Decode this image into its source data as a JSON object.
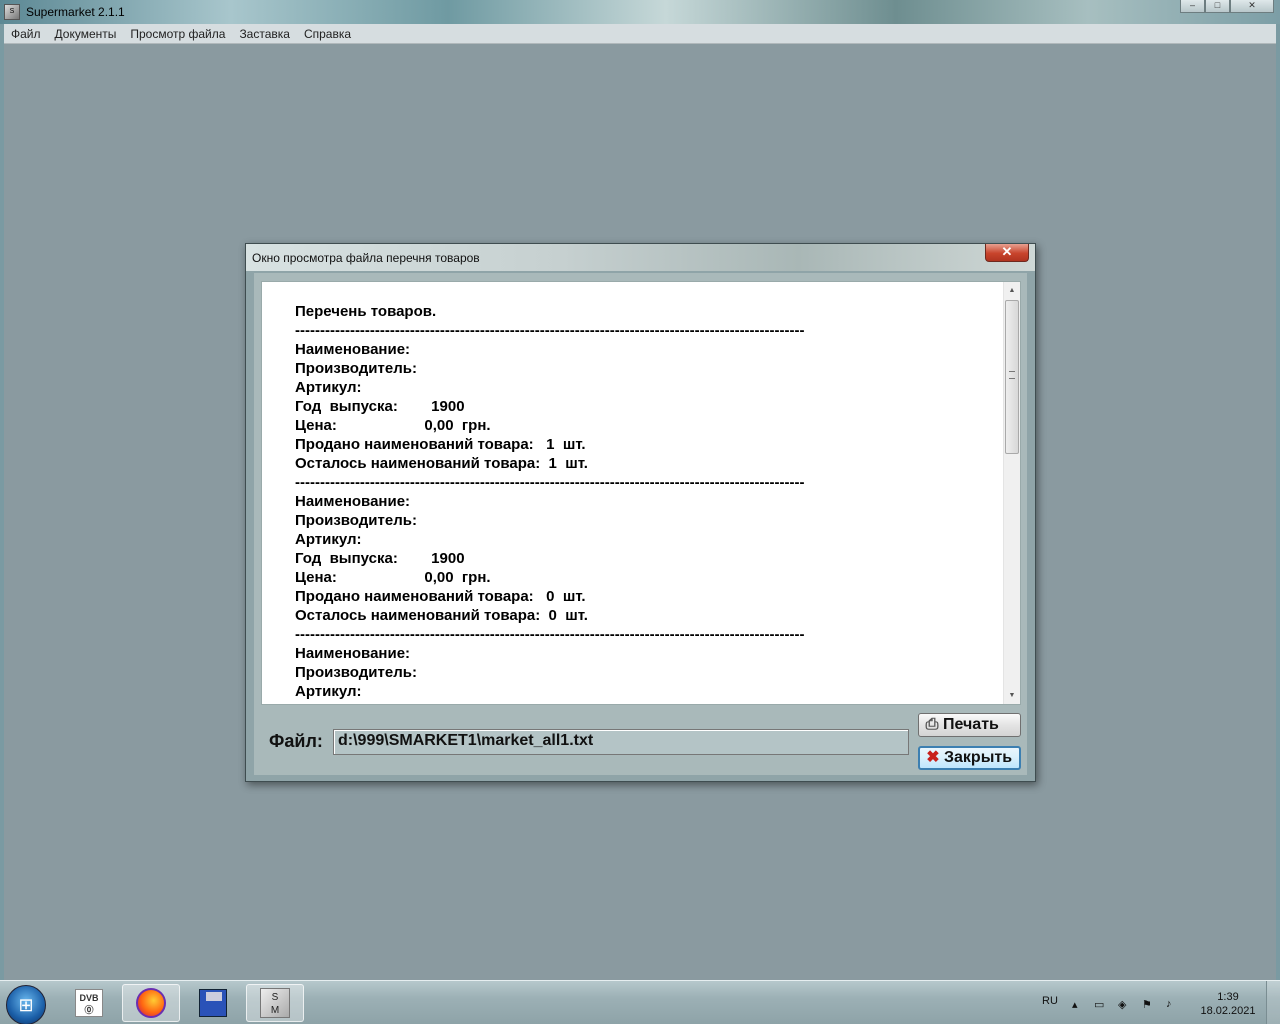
{
  "window": {
    "title": "Supermarket 2.1.1",
    "controls": {
      "minimize": "–",
      "maximize": "□",
      "close": "✕"
    }
  },
  "menu": {
    "items": [
      {
        "label": "Файл"
      },
      {
        "label": "Документы"
      },
      {
        "label": "Просмотр файла"
      },
      {
        "label": "Заставка"
      },
      {
        "label": "Справка"
      }
    ]
  },
  "dialog": {
    "title": "Окно просмотра файла перечня товаров",
    "close_label": "✕",
    "memo_text": "Перечень товаров.\n------------------------------------------------------------------------------------------------------\nНаименование:\nПроизводитель:\nАртикул:\nГод  выпуска:        1900\nЦена:                     0,00  грн.\nПродано наименований товара:   1  шт.\nОсталось наименований товара:  1  шт.\n------------------------------------------------------------------------------------------------------\nНаименование:\nПроизводитель:\nАртикул:\nГод  выпуска:        1900\nЦена:                     0,00  грн.\nПродано наименований товара:   0  шт.\nОсталось наименований товара:  0  шт.\n------------------------------------------------------------------------------------------------------\nНаименование:\nПроизводитель:\nАртикул:",
    "file_label": "Файл:",
    "file_path": "d:\\999\\SMARKET1\\market_all1.txt",
    "print_button": "Печать",
    "close_button": "Закрыть"
  },
  "taskbar": {
    "start_icon": "windows-logo-icon",
    "apps": [
      {
        "name": "dvb-app",
        "label_top": "DVB",
        "label_bottom": "⓪"
      },
      {
        "name": "firefox-app"
      },
      {
        "name": "floppy-app"
      },
      {
        "name": "supermarket-app",
        "label_top": "S",
        "label_bottom": "M"
      }
    ],
    "tray": {
      "language": "RU",
      "time": "1:39",
      "date": "18.02.2021"
    }
  }
}
